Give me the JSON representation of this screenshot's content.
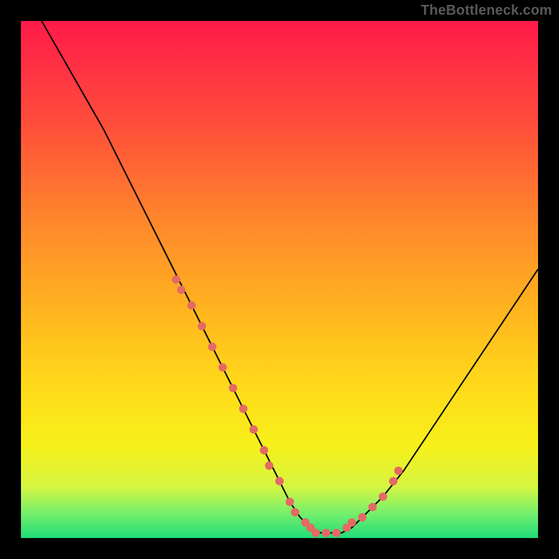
{
  "watermark": "TheBottleneck.com",
  "colors": {
    "page_bg": "#000000",
    "curve_stroke": "#000000",
    "dot_fill": "#e46a64",
    "gradient_stops": [
      {
        "offset": 0.0,
        "color": "#ff1a4a"
      },
      {
        "offset": 0.2,
        "color": "#ff4e3a"
      },
      {
        "offset": 0.4,
        "color": "#ff8a2a"
      },
      {
        "offset": 0.55,
        "color": "#ffb21f"
      },
      {
        "offset": 0.7,
        "color": "#ffd81a"
      },
      {
        "offset": 0.82,
        "color": "#f7f01a"
      },
      {
        "offset": 0.9,
        "color": "#d6f540"
      },
      {
        "offset": 0.95,
        "color": "#7af06a"
      },
      {
        "offset": 1.0,
        "color": "#1fdc7a"
      }
    ]
  },
  "chart_data": {
    "type": "line",
    "title": "",
    "xlabel": "",
    "ylabel": "",
    "xlim": [
      0,
      100
    ],
    "ylim": [
      0,
      100
    ],
    "series": [
      {
        "name": "curve",
        "x": [
          0,
          4,
          8,
          12,
          16,
          20,
          24,
          28,
          32,
          36,
          40,
          44,
          48,
          50,
          52,
          54,
          56,
          58,
          60,
          62,
          64,
          66,
          70,
          74,
          78,
          82,
          86,
          90,
          94,
          98,
          100
        ],
        "values": [
          104,
          100,
          93,
          86,
          79,
          71,
          63,
          55,
          47,
          39,
          31,
          23,
          15,
          11,
          7,
          4,
          2,
          1,
          1,
          1,
          2,
          4,
          8,
          13,
          19,
          25,
          31,
          37,
          43,
          49,
          52
        ]
      }
    ],
    "highlight_points": {
      "name": "dots",
      "x": [
        30,
        31,
        33,
        35,
        37,
        39,
        41,
        43,
        45,
        47,
        48,
        50,
        52,
        53,
        55,
        56,
        57,
        59,
        61,
        63,
        64,
        66,
        68,
        70,
        72,
        73
      ],
      "values": [
        50,
        48,
        45,
        41,
        37,
        33,
        29,
        25,
        21,
        17,
        14,
        11,
        7,
        5,
        3,
        2,
        1,
        1,
        1,
        2,
        3,
        4,
        6,
        8,
        11,
        13
      ]
    }
  }
}
